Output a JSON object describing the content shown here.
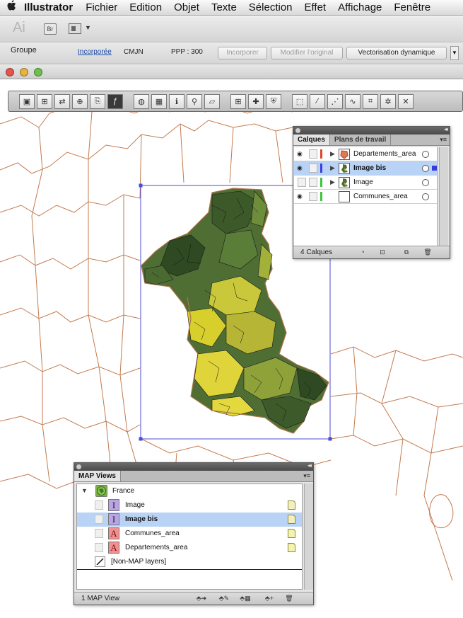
{
  "menubar": {
    "apple": "",
    "app_name": "Illustrator",
    "items": [
      "Fichier",
      "Edition",
      "Objet",
      "Texte",
      "Sélection",
      "Effet",
      "Affichage",
      "Fenêtre"
    ]
  },
  "appbar": {
    "logo": "Ai",
    "bridge_label": "Br"
  },
  "controlbar": {
    "group_label": "Groupe",
    "embedded_link": "Incorporée",
    "color_mode": "CMJN",
    "ppi": "PPP : 300",
    "embed_button": "Incorporer",
    "edit_original_button": "Modifier l'original",
    "live_trace_button": "Vectorisation dynamique"
  },
  "layers_panel": {
    "tabs": [
      "Calques",
      "Plans de travail"
    ],
    "layers": [
      {
        "name": "Departements_area",
        "visible": true,
        "color": "#e0452f",
        "selected": false
      },
      {
        "name": "Image bis",
        "visible": true,
        "color": "#3d3de0",
        "selected": true
      },
      {
        "name": "Image",
        "visible": false,
        "color": "#3ec43e",
        "selected": false
      },
      {
        "name": "Communes_area",
        "visible": true,
        "color": "#3ec43e",
        "selected": false
      }
    ],
    "footer": "4 Calques"
  },
  "map_views_panel": {
    "tab": "MAP Views",
    "root": "France",
    "items": [
      {
        "name": "Image",
        "type": "I",
        "selected": false
      },
      {
        "name": "Image bis",
        "type": "I",
        "selected": true
      },
      {
        "name": "Communes_area",
        "type": "A",
        "selected": false
      },
      {
        "name": "Departements_area",
        "type": "A",
        "selected": false
      }
    ],
    "non_map": "[Non-MAP layers]",
    "footer": "1 MAP View"
  },
  "colors": {
    "map_outline": "#c47a4e",
    "selection": "#4b4bd6",
    "map_dark": "#3b5a2b",
    "map_light": "#d8d83a"
  }
}
